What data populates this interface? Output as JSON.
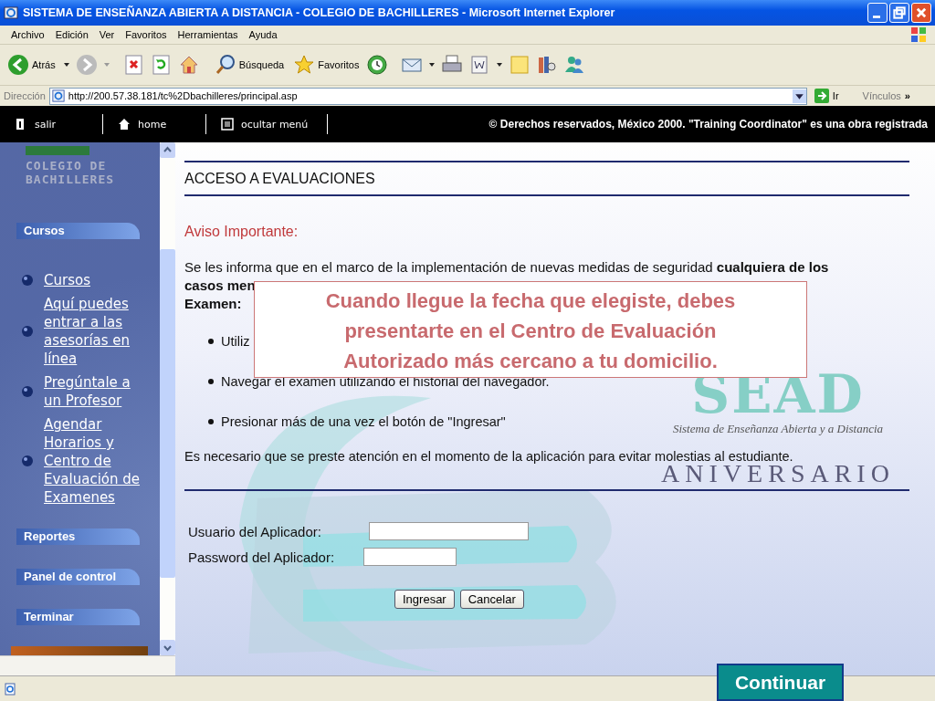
{
  "window": {
    "title": "SISTEMA DE ENSEÑANZA ABIERTA A DISTANCIA - COLEGIO DE BACHILLERES - Microsoft Internet Explorer"
  },
  "menu": [
    "Archivo",
    "Edición",
    "Ver",
    "Favoritos",
    "Herramientas",
    "Ayuda"
  ],
  "toolbar": [
    {
      "kind": "back",
      "label": "Atrás"
    },
    {
      "kind": "forward"
    },
    {
      "kind": "stop"
    },
    {
      "kind": "refresh"
    },
    {
      "kind": "home"
    },
    {
      "kind": "search",
      "label": "Búsqueda"
    },
    {
      "kind": "favorites",
      "label": "Favoritos"
    },
    {
      "kind": "history"
    },
    {
      "kind": "mail"
    },
    {
      "kind": "print"
    },
    {
      "kind": "edit"
    },
    {
      "kind": "note"
    },
    {
      "kind": "research"
    },
    {
      "kind": "messenger"
    }
  ],
  "address": {
    "label": "Dirección",
    "value": "http://200.57.38.181/tc%2Dbachilleres/principal.asp",
    "go": "Ir",
    "links": "Vínculos",
    "more": "»"
  },
  "site_nav": {
    "items": [
      {
        "kind": "exit",
        "label": "salir"
      },
      {
        "kind": "home",
        "label": "home"
      },
      {
        "kind": "hide",
        "label": "ocultar menú"
      }
    ],
    "copyright": "© Derechos reservados, México 2000. \"Training Coordinator\" es una obra registrada"
  },
  "sidebar": {
    "logo": "COLEGIO DE BACHILLERES",
    "sections": [
      {
        "title": "Cursos",
        "links": [
          "Cursos",
          "Aquí puedes entrar a las asesorías en línea",
          "Pregúntale a un Profesor",
          "Agendar Horarios y Centro de Evaluación de Examenes"
        ]
      },
      {
        "title": "Reportes"
      },
      {
        "title": "Panel de control"
      },
      {
        "title": "Terminar"
      }
    ]
  },
  "content": {
    "heading": "ACCESO A EVALUACIONES",
    "notice_title": "Aviso Importante:",
    "intro": [
      "Se les informa que en el marco de la implementación de nuevas medidas de seguridad **cualquiera de los**",
      "**casos men**",
      "**Examen:**"
    ],
    "bullets": [
      "Utiliz",
      "Navegar el examen utilizando el historial del navegador.",
      "Presionar más de una vez el botón de \"Ingresar\""
    ],
    "closing": "Es necesario que se preste atención en el momento de la aplicación para evitar molestias al estudiante.",
    "logo": {
      "name": "SEAD",
      "subtitle": "Sistema de Enseñanza Abierta y a Distancia",
      "anniversary": "ANIVERSARIO"
    },
    "fields": [
      {
        "label": "Usuario del Aplicador:"
      },
      {
        "label": "Password del Aplicador:"
      }
    ],
    "buttons": [
      "Ingresar",
      "Cancelar"
    ]
  },
  "callout": "Cuando llegue la fecha que elegiste, debes presentarte en el Centro de Evaluación Autorizado más cercano a tu domicilio.",
  "continue_button": "Continuar"
}
